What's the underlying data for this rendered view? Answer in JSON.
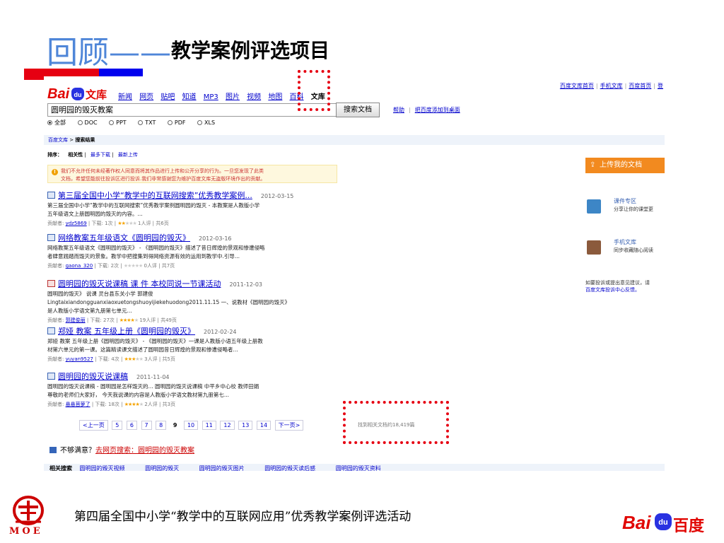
{
  "slide": {
    "title_part1": "回顾——",
    "title_part2": "教学案例评选项目",
    "footer": "第四届全国中小学“教学中的互联网应用”优秀教学案例评选活动",
    "moe_text": "MOE",
    "colors": {
      "title_blue": "#4f86d8",
      "bar_red": "#e60012",
      "bar_blue": "#0000ee",
      "highlight": "#e60012"
    }
  },
  "baidu_logo": {
    "bai": "Bai",
    "du": "du",
    "wenku": "文库",
    "bottom_text": "百度"
  },
  "toplinks": [
    "百度文库首页",
    "手机文库",
    "百度首页",
    "登"
  ],
  "nav": {
    "items": [
      "新闻",
      "网页",
      "贴吧",
      "知道",
      "MP3",
      "图片",
      "视频",
      "地图",
      "百科"
    ],
    "current": "文库"
  },
  "search": {
    "query": "圆明园的毁灭教案",
    "button": "搜索文档",
    "help": "帮助",
    "add_desktop": "把百度添加到桌面"
  },
  "filetypes": [
    {
      "label": "全部",
      "selected": true
    },
    {
      "label": "DOC",
      "selected": false
    },
    {
      "label": "PPT",
      "selected": false
    },
    {
      "label": "TXT",
      "selected": false
    },
    {
      "label": "PDF",
      "selected": false
    },
    {
      "label": "XLS",
      "selected": false
    }
  ],
  "breadcrumb": {
    "home": "百度文库",
    "sep": " > ",
    "current": "搜索结果"
  },
  "sort": {
    "label": "排序：",
    "options": [
      "相关性",
      "最多下载",
      "最新上传"
    ]
  },
  "warning": {
    "line1": "我们不允许任何未经著作权人同意而将其作品进行上传和公开分享的行为。一旦您发现了此类",
    "line2": "文档，希望您能前往投诉区进行投诉.我们非常感谢您为维护百度文库无盗版环境作出的贡献。"
  },
  "results": [
    {
      "title": "第三届全国中小学“教学中的互联网搜索”优秀教学案例...",
      "date": "2012-03-15",
      "desc1": "第三届全国中小学“教学中的互联网搜索”优秀教学案例圆明园的毁灭 - 本教案是人教版小学",
      "desc2": "五年级语文上册圆明园的毁灭的内容。...",
      "contributor": "ydz5869",
      "downloads": "下载: 1次",
      "rating": 2,
      "reviews": "1人评",
      "pages": "共6页",
      "type": "doc"
    },
    {
      "title": "网络教案五年级语文《圆明园的毁灭》",
      "date": "2012-03-16",
      "desc1": "网络教案五年级语文《圆明园的毁灭》 - 《圆明园的毁灭》描述了昔日辉煌的景观和惨遭侵略",
      "desc2": "者肆意践踏而毁灭的景象。教学中把搜集到得网络资源有效的运用到教学中.引导...",
      "contributor": "gaona_320",
      "downloads": "下载: 2次",
      "rating": 0,
      "reviews": "0人评",
      "pages": "共7页",
      "type": "doc"
    },
    {
      "title": "圆明园的毁灭说课稿    课  件  本校同说一节课活动",
      "date": "2011-12-03",
      "desc1": "圆明园的毁灭》 说课  灵台县东关小学  郭建俊",
      "desc2": "Lingtaixiandongguanxiaoxuetongshuoyijiekehuodong2011.11.15 一、说教材《圆明园的毁灭》",
      "desc3": "是人教版小学语文第九册第七单元...",
      "contributor": "郭建俊丽",
      "downloads": "下载: 27次",
      "rating": 4,
      "reviews": "19人评",
      "pages": "共49页",
      "type": "pdf"
    },
    {
      "title": "郑娅 教案 五年级上册《圆明园的毁灭》",
      "date": "2012-02-24",
      "desc1": "郑娅  教案  五年级上册《圆明园的毁灭》 - 《圆明园的毁灭》一课是人教版小语五年级上册教",
      "desc2": "材第六单元的第一课。这篇精读课文描述了圆明园昔日辉煌的景观和惨遭侵略者...",
      "contributor": "yuyan9527",
      "downloads": "下载: 4次",
      "rating": 3,
      "reviews": "3人评",
      "pages": "共5页",
      "type": "doc"
    },
    {
      "title": "圆明园的毁灭说课稿",
      "date": "2011-11-04",
      "desc1": "圆明园的毁灭说课稿 - 圆明园是怎样毁灭的... 圆明园的毁灭说课稿  中平乡中心校  教师田娟",
      "desc2": "尊敬的老师们大家好，  今天我说课的内容是人教版小学语文教材第九册第七...",
      "contributor": "悬悬苜萝了",
      "downloads": "下载: 18次",
      "rating": 4,
      "reviews": "2人评",
      "pages": "共3页",
      "type": "doc"
    }
  ],
  "labels": {
    "contributor_prefix": "贡献者:",
    "sep": " | "
  },
  "pager": {
    "prev": "<上一页",
    "pages": [
      "5",
      "6",
      "7",
      "8",
      "9",
      "10",
      "11",
      "12",
      "13",
      "14"
    ],
    "current": "9",
    "next": "下一页>"
  },
  "result_count": "找到相关文档约18,419篇",
  "unsatisfied": {
    "prefix": "不够满意？",
    "link": "去网页搜索：圆明园的毁灭教案"
  },
  "related": {
    "label": "相关搜索",
    "items": [
      "圆明园的毁灭视频",
      "圆明园的毁灭",
      "圆明园的毁灭图片",
      "圆明园的毁灭读后感",
      "圆明园的毁灭资料"
    ]
  },
  "sidebar": {
    "upload": "上传我的文档",
    "items": [
      {
        "title": "课件专区",
        "desc": "分享让你的课堂更"
      },
      {
        "title": "手机文库",
        "desc": "同步收藏随心阅读"
      }
    ],
    "note_line1": "如要投诉或提出意见建议，请",
    "note_line2": "百度文库投诉中心反馈。"
  }
}
